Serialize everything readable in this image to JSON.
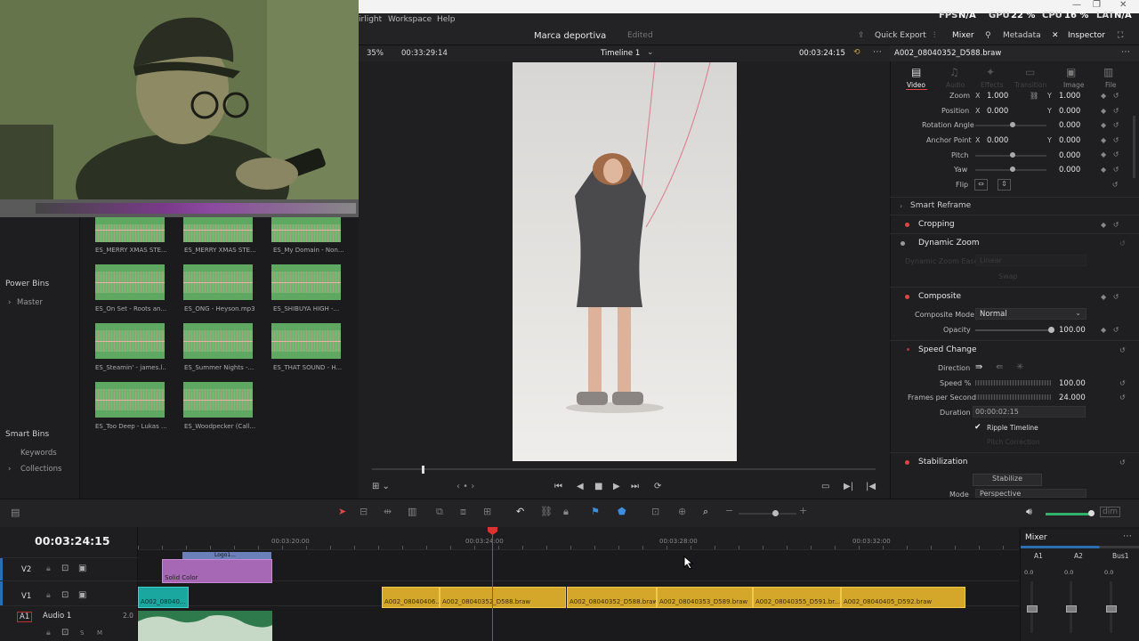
{
  "app": {
    "menu": [
      "irlight",
      "Workspace",
      "Help"
    ],
    "stats": {
      "fps_label": "FPS",
      "fps": "N/A",
      "gpu_label": "GPU",
      "gpu": "22 %",
      "cpu_label": "CPU",
      "cpu": "16 %",
      "lat_label": "LAT",
      "lat": "N/A"
    }
  },
  "project": {
    "name": "Marca deportiva",
    "status": "Edited",
    "quick_export": "Quick Export",
    "mixer": "Mixer",
    "metadata": "Metadata",
    "inspector": "Inspector"
  },
  "viewer": {
    "zoom": "35%",
    "timecode_left": "00:33:29:14",
    "timeline_name": "Timeline 1",
    "timecode_right": "00:03:24:15"
  },
  "bins": {
    "power_bins": "Power Bins",
    "master": "Master",
    "smart_bins": "Smart Bins",
    "keywords": "Keywords",
    "collections": "Collections"
  },
  "media": [
    {
      "name": "ES_MERRY XMAS STE..."
    },
    {
      "name": "ES_MERRY XMAS STE..."
    },
    {
      "name": "ES_My Domain - Non..."
    },
    {
      "name": "ES_On Set - Roots an..."
    },
    {
      "name": "ES_ONG - Heyson.mp3"
    },
    {
      "name": "ES_SHIBUYA HIGH -..."
    },
    {
      "name": "ES_Steamin' - james.l..."
    },
    {
      "name": "ES_Summer Nights -..."
    },
    {
      "name": "ES_THAT SOUND - H..."
    },
    {
      "name": "ES_Too Deep - Lukas ..."
    },
    {
      "name": "ES_Woodpecker (Call..."
    }
  ],
  "inspector": {
    "clip_name": "A002_08040352_D588.braw",
    "tabs": [
      "Video",
      "Audio",
      "Effects",
      "Transition",
      "Image",
      "File"
    ],
    "zoom_label": "Zoom",
    "zoom_x": "1.000",
    "zoom_y": "1.000",
    "position_label": "Position",
    "pos_x": "0.000",
    "pos_y": "0.000",
    "rotation_label": "Rotation Angle",
    "rotation": "0.000",
    "anchor_label": "Anchor Point",
    "anchor_x": "0.000",
    "anchor_y": "0.000",
    "pitch_label": "Pitch",
    "pitch": "0.000",
    "yaw_label": "Yaw",
    "yaw": "0.000",
    "flip_label": "Flip",
    "x": "X",
    "y": "Y",
    "smart_reframe": "Smart Reframe",
    "cropping": "Cropping",
    "dynamic_zoom": "Dynamic Zoom",
    "dz_ease_label": "Dynamic Zoom Ease",
    "dz_ease": "Linear",
    "swap": "Swap",
    "composite": "Composite",
    "composite_mode_label": "Composite Mode",
    "composite_mode": "Normal",
    "opacity_label": "Opacity",
    "opacity": "100.00",
    "speed_change": "Speed Change",
    "direction_label": "Direction",
    "speed_label": "Speed %",
    "speed": "100.00",
    "fps_label": "Frames per Second",
    "fps": "24.000",
    "duration_label": "Duration",
    "duration": "00:00:02:15",
    "ripple": "Ripple Timeline",
    "pitch_correction": "Pitch Correction",
    "stabilization": "Stabilization",
    "stabilize": "Stabilize",
    "mode_label": "Mode",
    "mode": "Perspective"
  },
  "timeline": {
    "timecode": "00:03:24:15",
    "ruler": [
      "00:03:20:00",
      "00:03:24:00",
      "00:03:28:00",
      "00:03:32:00"
    ],
    "tracks": {
      "v2": "V2",
      "v1": "V1",
      "a1": "A1",
      "a1_name": "Audio 1",
      "a1_level": "2.0"
    },
    "v2_clips": [
      "Logo1...",
      "Solid Color"
    ],
    "v1_clips": [
      "A002_08040...",
      "A002_08040406...",
      "A002_08040352_D588.braw",
      "A002_08040352_D588.braw",
      "A002_08040353_D589.braw",
      "A002_08040355_D591.br...",
      "A002_08040405_D592.braw"
    ]
  },
  "mixer": {
    "title": "Mixer",
    "channels": [
      "A1",
      "A2",
      "Bus1"
    ],
    "levels": [
      "0.0",
      "0.0",
      "0.0"
    ]
  },
  "colors": {
    "accent_red": "#e0322c",
    "clip_yellow": "#d4a72a",
    "clip_teal": "#19a7a0",
    "clip_purple": "#a667b5",
    "audio_green": "#5fa862"
  }
}
